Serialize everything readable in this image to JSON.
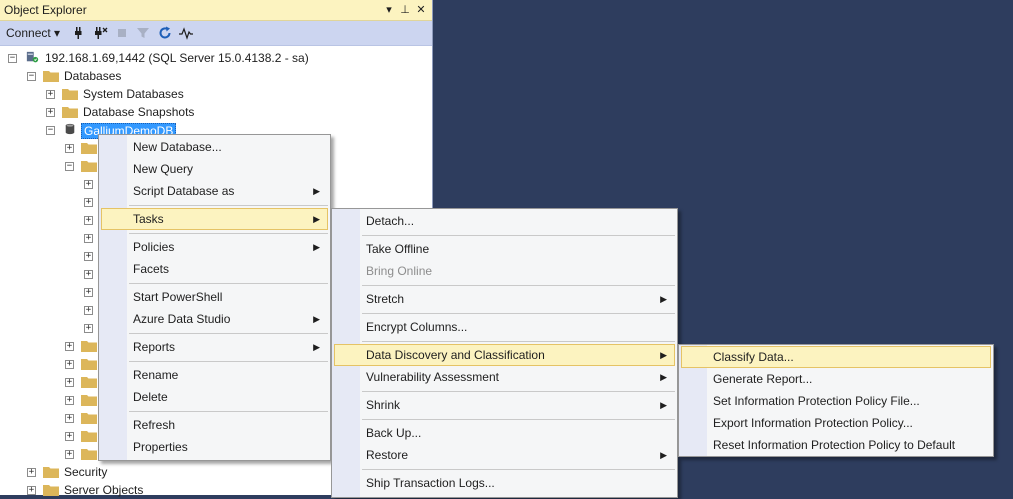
{
  "panel": {
    "title": "Object Explorer",
    "title_buttons": [
      "▾",
      "⊥",
      "✕"
    ],
    "toolbar": {
      "connect_label": "Connect ▾",
      "icons": [
        "connect-plug-icon",
        "disconnect-plug-icon",
        "stop-icon",
        "filter-icon",
        "refresh-icon",
        "activity-monitor-icon"
      ]
    }
  },
  "tree": {
    "server": "192.168.1.69,1442 (SQL Server 15.0.4138.2 - sa)",
    "databases": "Databases",
    "system_databases": "System Databases",
    "database_snapshots": "Database Snapshots",
    "selected_db": "GalliumDemoDB",
    "security": "Security",
    "server_objects": "Server Objects"
  },
  "menu_main": {
    "items": [
      {
        "label": "New Database..."
      },
      {
        "label": "New Query"
      },
      {
        "label": "Script Database as",
        "submenu": true
      },
      {
        "label": "Tasks",
        "submenu": true,
        "highlighted": true
      },
      {
        "label": "Policies",
        "submenu": true
      },
      {
        "label": "Facets"
      },
      {
        "label": "Start PowerShell"
      },
      {
        "label": "Azure Data Studio",
        "submenu": true
      },
      {
        "label": "Reports",
        "submenu": true
      },
      {
        "label": "Rename"
      },
      {
        "label": "Delete"
      },
      {
        "label": "Refresh"
      },
      {
        "label": "Properties"
      }
    ]
  },
  "menu_tasks": {
    "items": [
      {
        "label": "Detach..."
      },
      {
        "label": "Take Offline"
      },
      {
        "label": "Bring Online",
        "disabled": true
      },
      {
        "label": "Stretch",
        "submenu": true
      },
      {
        "label": "Encrypt Columns..."
      },
      {
        "label": "Data Discovery and Classification",
        "submenu": true,
        "highlighted": true
      },
      {
        "label": "Vulnerability Assessment",
        "submenu": true
      },
      {
        "label": "Shrink",
        "submenu": true
      },
      {
        "label": "Back Up..."
      },
      {
        "label": "Restore",
        "submenu": true
      },
      {
        "label": "Ship Transaction Logs..."
      }
    ]
  },
  "menu_ddc": {
    "items": [
      {
        "label": "Classify Data...",
        "highlighted": true
      },
      {
        "label": "Generate Report..."
      },
      {
        "label": "Set Information Protection Policy File..."
      },
      {
        "label": "Export Information Protection Policy..."
      },
      {
        "label": "Reset Information Protection Policy to Default"
      }
    ]
  },
  "colors": {
    "background": "#2e3d5e",
    "highlight": "#fcf3c0",
    "highlight_border": "#e5c365",
    "selection": "#3399ff",
    "folder": "#dcb65a"
  }
}
